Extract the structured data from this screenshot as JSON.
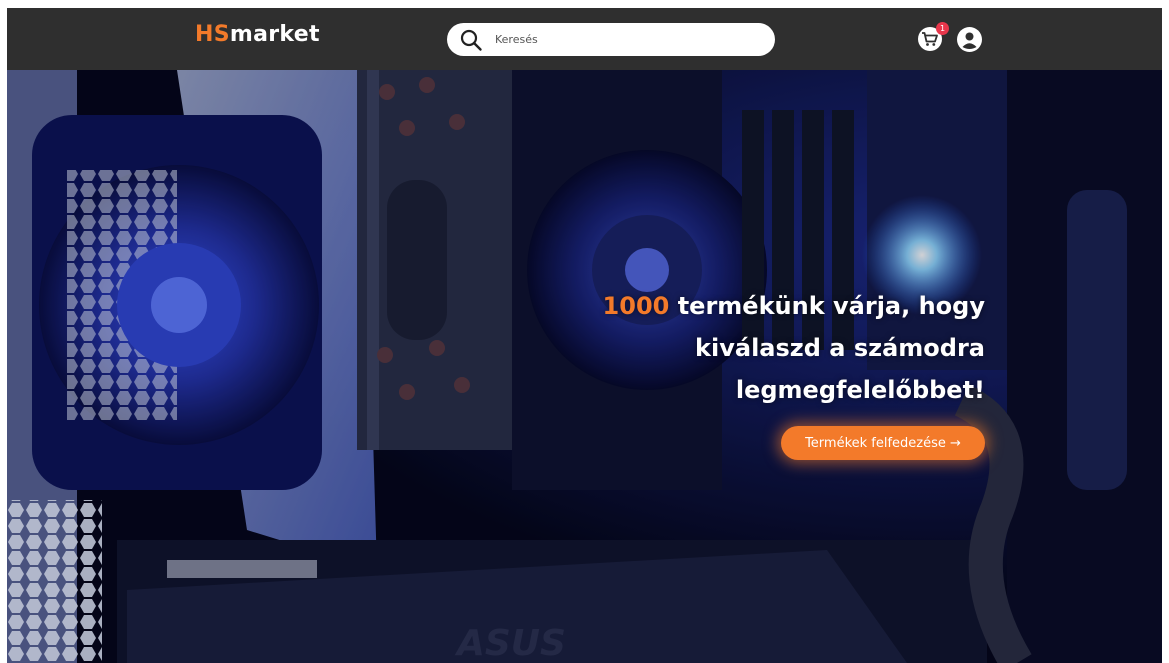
{
  "navbar": {
    "logo_prefix": "HS",
    "logo_suffix": "market",
    "search_placeholder": "Keresés",
    "search_icon": "search-icon",
    "cart_icon": "cart-icon",
    "cart_count": "1",
    "user_icon": "user-icon",
    "background": "#2f2f2f",
    "accent": "#f37a2a"
  },
  "hero": {
    "highlight_number": "1000",
    "headline_line1": " termékünk várja, hogy",
    "headline_line2": "kiválaszd a számodra",
    "headline_line3": "legmegfelelőbbet!",
    "cta_label": "Termékek felfedezése →",
    "cta_color": "#f37a2a"
  }
}
